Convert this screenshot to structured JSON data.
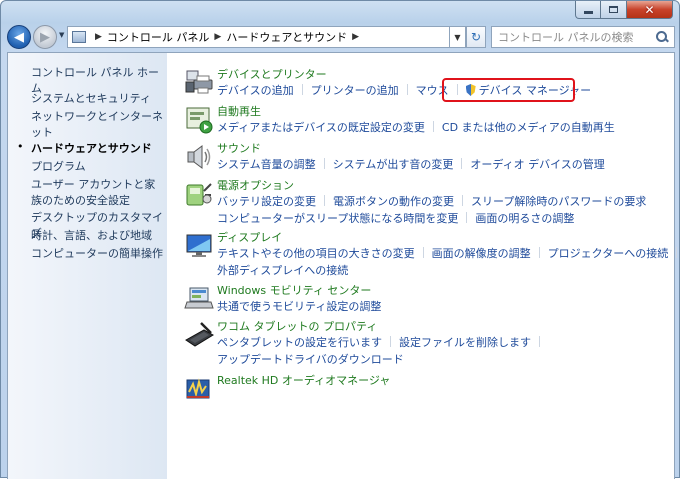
{
  "window": {
    "close_glyph": "✕"
  },
  "nav": {
    "back_glyph": "◀",
    "forward_glyph": "▶",
    "breadcrumb": [
      "コントロール パネル",
      "ハードウェアとサウンド"
    ],
    "refresh_glyph": "↻",
    "search_placeholder": "コントロール パネルの検索"
  },
  "sidebar": {
    "items": [
      {
        "label": "コントロール パネル ホーム"
      },
      {
        "label": "システムとセキュリティ"
      },
      {
        "label": "ネットワークとインターネット"
      },
      {
        "label": "ハードウェアとサウンド",
        "current": true
      },
      {
        "label": "プログラム"
      },
      {
        "label": "ユーザー アカウントと家族のための安全設定"
      },
      {
        "label": "デスクトップのカスタマイズ"
      },
      {
        "label": "時計、言語、および地域"
      },
      {
        "label": "コンピューターの簡単操作"
      }
    ]
  },
  "categories": [
    {
      "title": "デバイスとプリンター",
      "icon": "printer-icon",
      "links": [
        "デバイスの追加",
        "プリンターの追加",
        "マウス",
        "デバイス マネージャー"
      ]
    },
    {
      "title": "自動再生",
      "icon": "autoplay-icon",
      "links": [
        "メディアまたはデバイスの既定設定の変更",
        "CD または他のメディアの自動再生"
      ]
    },
    {
      "title": "サウンド",
      "icon": "speaker-icon",
      "links": [
        "システム音量の調整",
        "システムが出す音の変更",
        "オーディオ デバイスの管理"
      ]
    },
    {
      "title": "電源オプション",
      "icon": "power-options-icon",
      "links": [
        "バッテリ設定の変更",
        "電源ボタンの動作の変更",
        "スリープ解除時のパスワードの要求",
        "コンピューターがスリープ状態になる時間を変更",
        "画面の明るさの調整"
      ]
    },
    {
      "title": "ディスプレイ",
      "icon": "display-icon",
      "links": [
        "テキストやその他の項目の大きさの変更",
        "画面の解像度の調整",
        "プロジェクターへの接続",
        "外部ディスプレイへの接続"
      ]
    },
    {
      "title": "Windows モビリティ センター",
      "icon": "mobility-center-icon",
      "links": [
        "共通で使うモビリティ設定の調整"
      ]
    },
    {
      "title": "ワコム タブレットの プロパティ",
      "icon": "tablet-icon",
      "links": [
        "ペンタブレットの設定を行います",
        "設定ファイルを削除します",
        "アップデートドライバのダウンロード"
      ]
    },
    {
      "title": "Realtek HD オーディオマネージャ",
      "icon": "realtek-audio-icon",
      "links": []
    }
  ]
}
